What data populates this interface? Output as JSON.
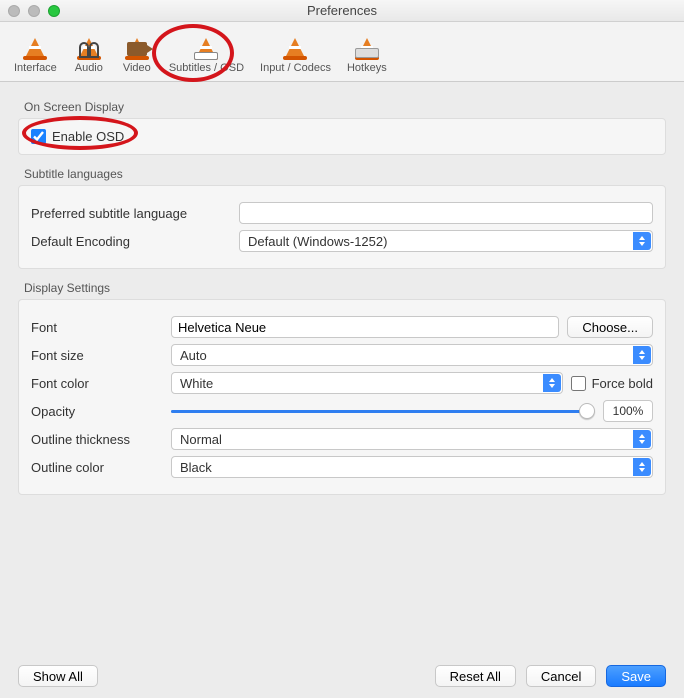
{
  "window": {
    "title": "Preferences"
  },
  "tabs": {
    "interface": "Interface",
    "audio": "Audio",
    "video": "Video",
    "subtitles": "Subtitles / OSD",
    "codecs": "Input / Codecs",
    "hotkeys": "Hotkeys"
  },
  "osd": {
    "group": "On Screen Display",
    "enable_label": "Enable OSD",
    "enable_checked": true
  },
  "lang": {
    "group": "Subtitle languages",
    "preferred_label": "Preferred subtitle language",
    "preferred_value": "",
    "encoding_label": "Default Encoding",
    "encoding_value": "Default (Windows-1252)"
  },
  "display": {
    "group": "Display Settings",
    "font_label": "Font",
    "font_value": "Helvetica Neue",
    "choose_label": "Choose...",
    "size_label": "Font size",
    "size_value": "Auto",
    "color_label": "Font color",
    "color_value": "White",
    "forcebold_label": "Force bold",
    "forcebold_checked": false,
    "opacity_label": "Opacity",
    "opacity_value": "100%",
    "thick_label": "Outline thickness",
    "thick_value": "Normal",
    "ocolor_label": "Outline color",
    "ocolor_value": "Black"
  },
  "footer": {
    "showall": "Show All",
    "reset": "Reset All",
    "cancel": "Cancel",
    "save": "Save"
  }
}
